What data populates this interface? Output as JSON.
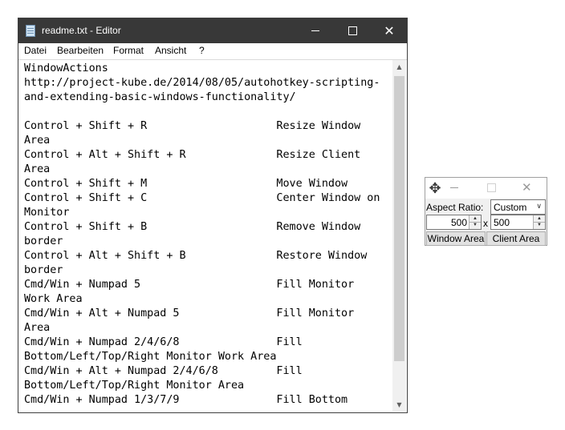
{
  "notepad": {
    "title": "readme.txt - Editor",
    "menu": [
      "Datei",
      "Bearbeiten",
      "Format",
      "Ansicht",
      "?"
    ],
    "text_lines": [
      "WindowActions",
      "http://project-kube.de/2014/08/05/autohotkey-scripting-",
      "and-extending-basic-windows-functionality/",
      "",
      "Control + Shift + R                    Resize Window",
      "Area",
      "Control + Alt + Shift + R              Resize Client",
      "Area",
      "Control + Shift + M                    Move Window",
      "Control + Shift + C                    Center Window on",
      "Monitor",
      "Control + Shift + B                    Remove Window",
      "border",
      "Control + Alt + Shift + B              Restore Window",
      "border",
      "Cmd/Win + Numpad 5                     Fill Monitor",
      "Work Area",
      "Cmd/Win + Alt + Numpad 5               Fill Monitor",
      "Area",
      "Cmd/Win + Numpad 2/4/6/8               Fill",
      "Bottom/Left/Top/Right Monitor Work Area",
      "Cmd/Win + Alt + Numpad 2/4/6/8         Fill",
      "Bottom/Left/Top/Right Monitor Area",
      "Cmd/Win + Numpad 1/3/7/9               Fill Bottom"
    ],
    "icons": {
      "app": "notepad-icon",
      "minimize": "minimize-icon",
      "maximize": "maximize-icon",
      "close": "close-icon",
      "close_glyph": "✕",
      "scroll_up": "▲",
      "scroll_down": "▼"
    }
  },
  "tool": {
    "aspect_label": "Aspect Ratio:",
    "aspect_selected": "Custom",
    "width_value": "500",
    "x_separator": "x",
    "height_value": "500",
    "window_area_label": "Window Area",
    "client_area_label": "Client Area",
    "icons": {
      "move": "✥",
      "close": "✕",
      "dropdown": "∨",
      "spin_up": "▲",
      "spin_down": "▼"
    }
  },
  "colors": {
    "titlebar": "#383838",
    "scroll_thumb": "#cdcdcd",
    "button_face": "#e1e1e1"
  }
}
